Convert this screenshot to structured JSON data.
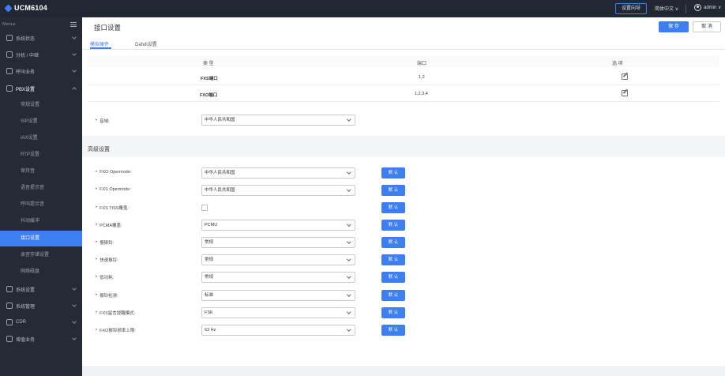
{
  "topbar": {
    "app_title": "UCM6104",
    "wizard_label": "设置向导",
    "language": "简体中文 ∨",
    "user": "admin ∨"
  },
  "sidebar": {
    "menus_label": "Menus",
    "groups": [
      {
        "label": "系统状态"
      },
      {
        "label": "分机 / 中继"
      },
      {
        "label": "呼叫业务"
      },
      {
        "label": "PBX设置"
      },
      {
        "label": "系统设置"
      },
      {
        "label": "系统管理"
      },
      {
        "label": "CDR"
      },
      {
        "label": "增值业务"
      }
    ],
    "sub_items": [
      {
        "label": "常规设置"
      },
      {
        "label": "SIP设置"
      },
      {
        "label": "IAX设置"
      },
      {
        "label": "RTP设置"
      },
      {
        "label": "保持音"
      },
      {
        "label": "语音提示音"
      },
      {
        "label": "呼叫提示音"
      },
      {
        "label": "抖动缓冲"
      },
      {
        "label": "接口设置"
      },
      {
        "label": "录音存储设置"
      },
      {
        "label": "网络磁盘"
      }
    ]
  },
  "header": {
    "title": "接口设置",
    "save_label": "保 存",
    "cancel_label": "取 消"
  },
  "tabs": [
    {
      "label": "模拟硬件",
      "active": true
    },
    {
      "label": "Dahdi设置",
      "active": false
    }
  ],
  "table": {
    "columns": [
      "类 型",
      "端口",
      "选 项"
    ],
    "rows": [
      {
        "type": "FXS端口",
        "ports": "1,2"
      },
      {
        "type": "FXO端口",
        "ports": "1,2,3,4"
      }
    ]
  },
  "tone_zone": {
    "label": "音域:",
    "value": "中华人民共和国"
  },
  "advanced": {
    "title": "高级设置",
    "default_label": "默 认",
    "fields": [
      {
        "label": "FXO Opermode:",
        "value": "中华人民共和国",
        "kind": "select"
      },
      {
        "label": "FXS Opermode:",
        "value": "中华人民共和国",
        "kind": "select"
      },
      {
        "label": "FXS TISS覆盖:",
        "value": "",
        "kind": "checkbox"
      },
      {
        "label": "PCMA覆盖:",
        "value": "PCMU",
        "kind": "select"
      },
      {
        "label": "慢振铃:",
        "value": "常规",
        "kind": "select"
      },
      {
        "label": "快速振铃:",
        "value": "常规",
        "kind": "select"
      },
      {
        "label": "低功耗:",
        "value": "常规",
        "kind": "select"
      },
      {
        "label": "振铃检测:",
        "value": "标准",
        "kind": "select"
      },
      {
        "label": "FXS留言提醒模式:",
        "value": "FSK",
        "kind": "select"
      },
      {
        "label": "FXO振铃频率上限:",
        "value": "63 Hz",
        "kind": "select"
      }
    ]
  },
  "colors": {
    "accent": "#3d7ff0",
    "sidebar_bg": "#252b36",
    "topbar_bg": "#222833",
    "required": "#e0474c"
  }
}
